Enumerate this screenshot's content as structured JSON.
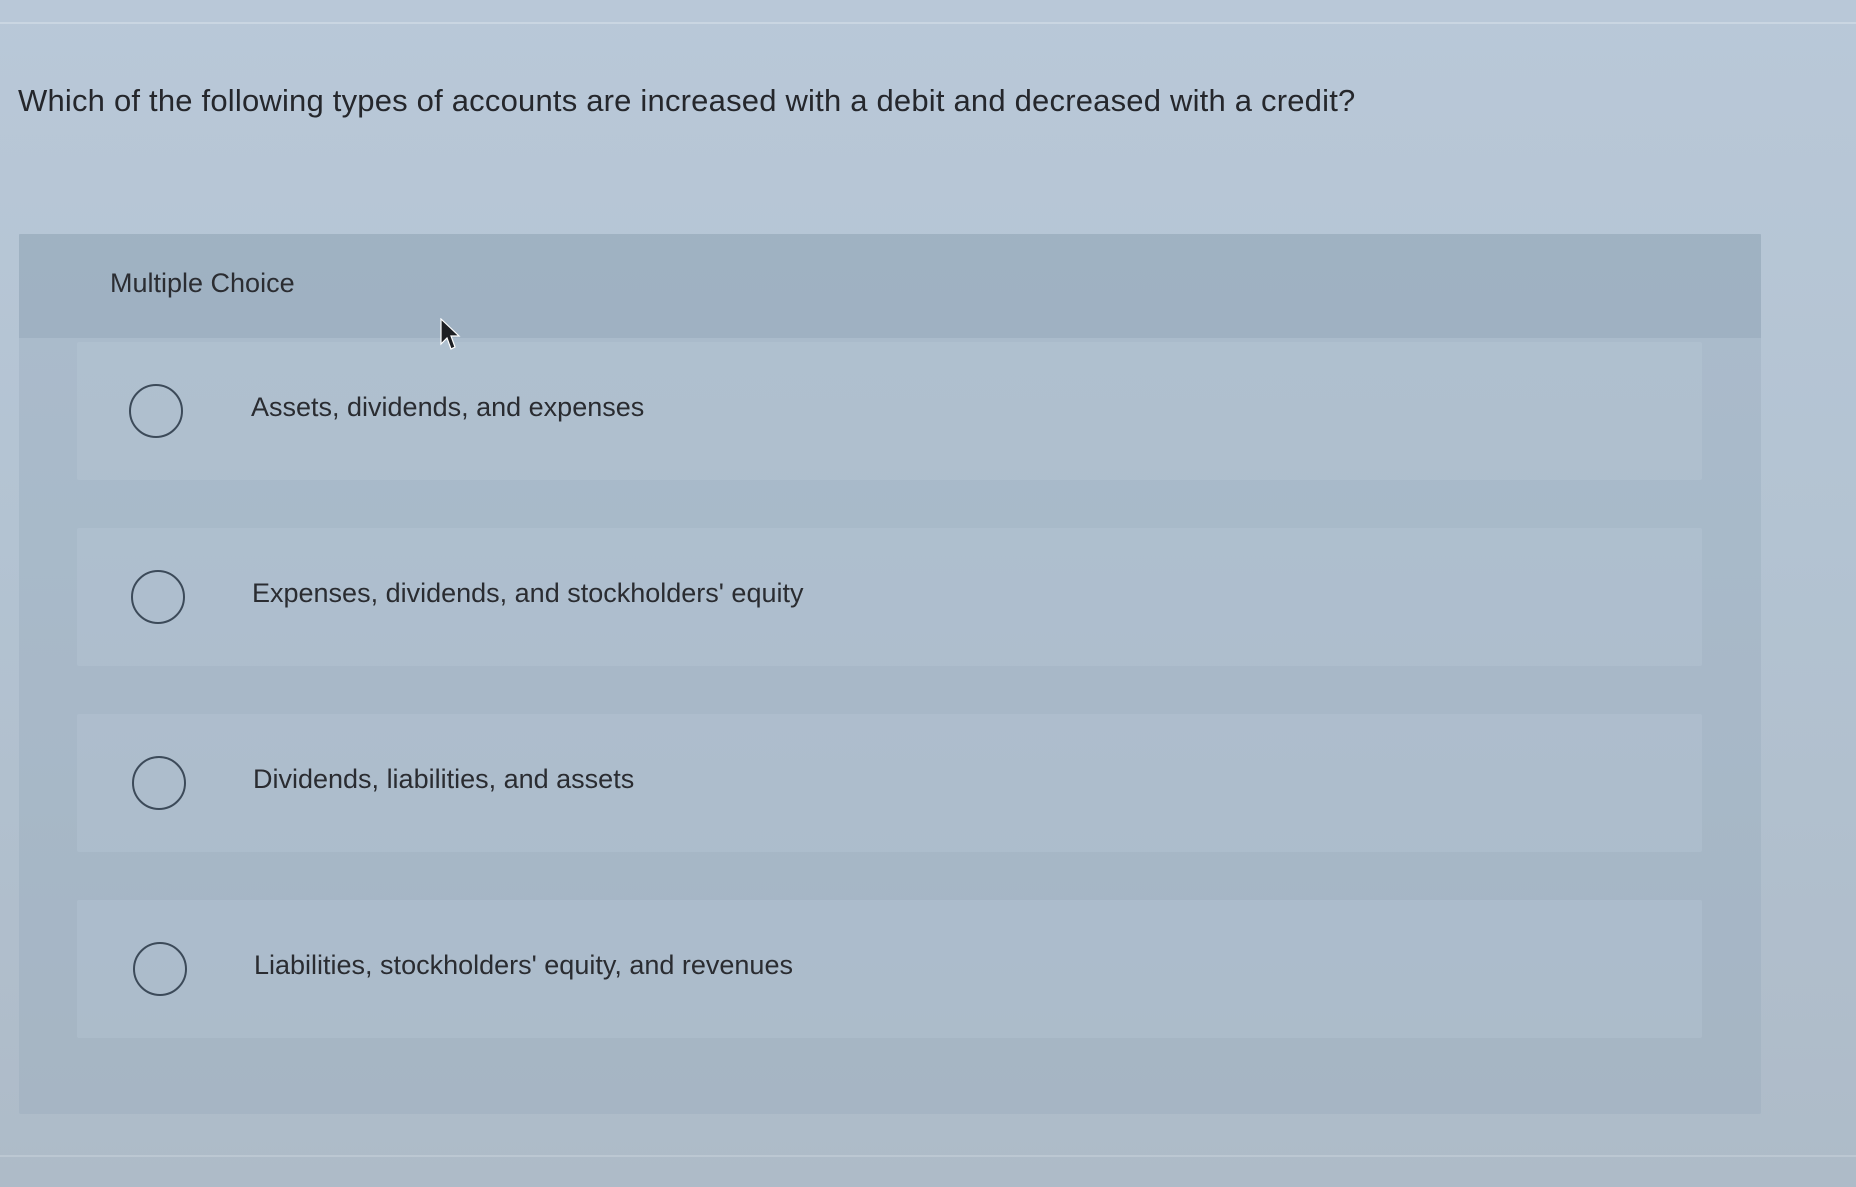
{
  "question": {
    "text": "Which of the following types of accounts are increased with a debit and decreased with a credit?"
  },
  "multiple_choice": {
    "title": "Multiple Choice",
    "options": [
      {
        "label": "Assets, dividends, and expenses",
        "selected": false
      },
      {
        "label": "Expenses, dividends, and stockholders' equity",
        "selected": false
      },
      {
        "label": "Dividends, liabilities, and assets",
        "selected": false
      },
      {
        "label": "Liabilities, stockholders' equity, and revenues",
        "selected": false
      }
    ]
  },
  "icons": {
    "cursor": "mouse-pointer-icon",
    "radio": "radio-button-icon"
  },
  "colors": {
    "background": "#b6c5d4",
    "text": "#2a2c31",
    "radio_border": "#3c4a59"
  }
}
